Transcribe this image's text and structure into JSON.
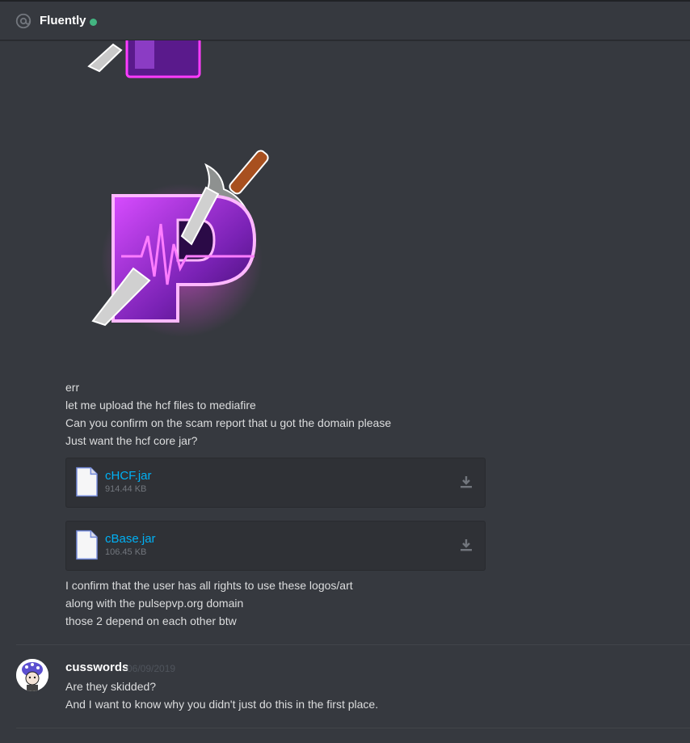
{
  "header": {
    "channel_name": "Fluently",
    "icon": "at-icon",
    "status": "online",
    "status_color": "#43b581"
  },
  "messages_top": [
    "err",
    "let me upload the hcf files to mediafire",
    "Can you confirm on the scam report that u got the domain please",
    "Just want the hcf core jar?"
  ],
  "attachments": [
    {
      "name": "cHCF.jar",
      "size": "914.44 KB"
    },
    {
      "name": "cBase.jar",
      "size": "106.45 KB"
    }
  ],
  "messages_after": [
    "I confirm that the user has all rights to use these logos/art",
    "along with the pulsepvp.org domain",
    "those 2 depend on each other btw"
  ],
  "next_author": {
    "username": "cusswords",
    "timestamp": "06/09/2019",
    "lines": [
      "Are they skidded?",
      "And I want to know why you didn't just do this in the first place."
    ]
  },
  "colors": {
    "background": "#36393f",
    "link": "#00b0f4",
    "attachment_bg": "#2f3136"
  }
}
